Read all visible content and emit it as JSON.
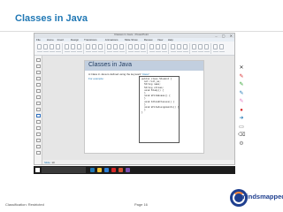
{
  "slide": {
    "title": "Classes in Java"
  },
  "screen": {
    "window_title": "Classes in Java - PowerPoint",
    "window_controls": "– ▢ ✕",
    "menu": [
      "File",
      "Home",
      "Insert",
      "Design",
      "Transitions",
      "Animations",
      "Slide Show",
      "Review",
      "View",
      "Help"
    ],
    "thumbnails_count_label": "",
    "page": {
      "title": "Classes in Java",
      "text_before": "A Class in Java is defined using the keyword",
      "keyword": "\"class\"",
      "text_after": ".",
      "example_label": "For example:",
      "code": [
        "public class Student {",
        "  int roll_no;",
        "  String name;",
        "  String stream;",
        "",
        "  void Study() {",
        "  }",
        "",
        "  void WriteExams() {",
        "  }",
        "",
        "  void AttendClasses() {",
        "  }",
        "",
        "  void WriteAssignments() {",
        "  }",
        "}"
      ]
    },
    "status": {
      "slide_label": "Slide:",
      "slide_value": "10"
    },
    "side_toolbar": [
      {
        "icon": "close-icon",
        "glyph": "✕",
        "color": "#333333"
      },
      {
        "icon": "pen-icon",
        "glyph": "✎",
        "color": "#d62728"
      },
      {
        "icon": "highlighter-icon",
        "glyph": "✎",
        "color": "#2ca02c"
      },
      {
        "icon": "marker-icon",
        "glyph": "✎",
        "color": "#1f77b4"
      },
      {
        "icon": "brush-icon",
        "glyph": "✎",
        "color": "#e377c2"
      },
      {
        "icon": "laser-icon",
        "glyph": "●",
        "color": "#d62728"
      },
      {
        "icon": "arrow-icon",
        "glyph": "➜",
        "color": "#1f77b4"
      },
      {
        "icon": "eraser-icon",
        "glyph": "▭",
        "color": "#555555"
      },
      {
        "icon": "clear-icon",
        "glyph": "⌫",
        "color": "#555555"
      },
      {
        "icon": "settings-icon",
        "glyph": "⚙",
        "color": "#777777"
      }
    ],
    "taskbar": {
      "apps": [
        {
          "icon": "edge-icon",
          "color": "#1f77b4"
        },
        {
          "icon": "folder-icon",
          "color": "#f0c030"
        },
        {
          "icon": "store-icon",
          "color": "#2f7fd6"
        },
        {
          "icon": "chrome-icon",
          "color": "#d62728"
        },
        {
          "icon": "powerpoint-icon",
          "color": "#d35230"
        },
        {
          "icon": "ide-icon",
          "color": "#7a4fb0"
        }
      ],
      "tray_text": ""
    }
  },
  "footer": {
    "classification": "Classification: Restricted",
    "page": "Page 16",
    "logo_text": "mindsmapped"
  },
  "colors": {
    "accent": "#1f77b4",
    "logo_blue": "#1f3f8f",
    "logo_orange": "#ff8a3d"
  }
}
